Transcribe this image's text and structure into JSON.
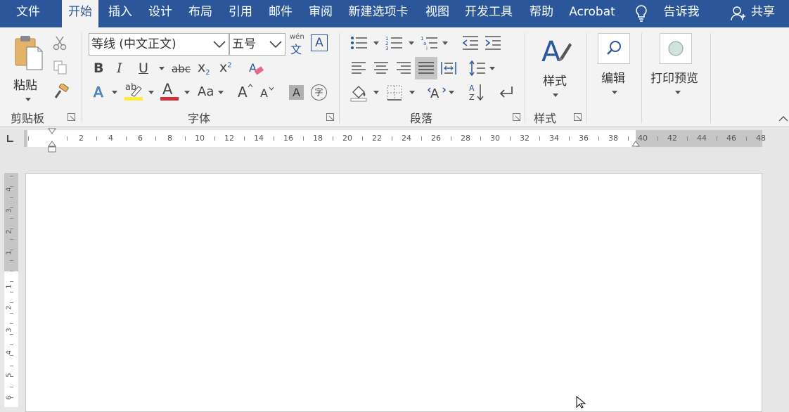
{
  "menu": {
    "tabs": [
      "文件",
      "开始",
      "插入",
      "设计",
      "布局",
      "引用",
      "邮件",
      "审阅",
      "新建选项卡",
      "视图",
      "开发工具",
      "帮助",
      "Acrobat"
    ],
    "active": "开始",
    "tell_me": "告诉我",
    "share": "共享"
  },
  "clipboard": {
    "paste_label": "粘贴",
    "group_label": "剪贴板"
  },
  "font": {
    "font_name": "等线 (中文正文)",
    "font_size": "五号",
    "phonetic_top": "wén",
    "phonetic_bottom": "文",
    "border_char": "A",
    "bold": "B",
    "italic": "I",
    "underline": "U",
    "strike": "abc",
    "subscript": "x",
    "sub_mark": "2",
    "superscript": "x",
    "sup_mark": "2",
    "text_effect": "A",
    "highlight": "ab",
    "font_color": "A",
    "change_case": "Aa",
    "grow": "A",
    "shrink": "A",
    "char_shading": "A",
    "enclose": "字",
    "group_label": "字体"
  },
  "paragraph": {
    "group_label": "段落"
  },
  "styles": {
    "label": "样式",
    "group_label": "样式"
  },
  "editing": {
    "label": "编辑"
  },
  "print_preview": {
    "label": "打印预览"
  },
  "ruler": {
    "h_numbers": [
      "2",
      "4",
      "6",
      "8",
      "10",
      "12",
      "14",
      "16",
      "18",
      "20",
      "22",
      "24",
      "26",
      "28",
      "30",
      "32",
      "34",
      "36",
      "38",
      "40",
      "42",
      "44",
      "46",
      "48"
    ],
    "v_numbers": [
      "4",
      "3",
      "2",
      "1",
      "1",
      "2",
      "3",
      "4",
      "5",
      "6"
    ]
  },
  "colors": {
    "brand": "#2b579a",
    "highlight": "#ffeb3b",
    "font_color": "#d13438"
  }
}
